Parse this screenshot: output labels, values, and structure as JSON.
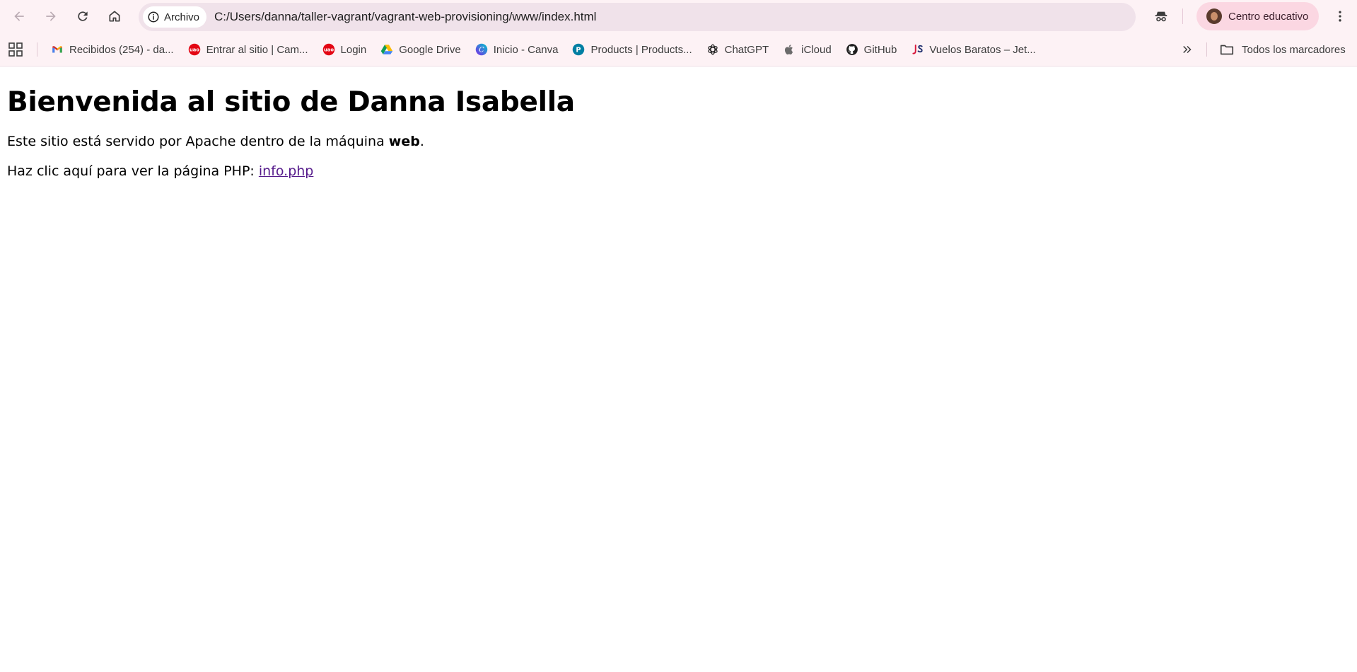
{
  "toolbar": {
    "back_icon": "arrow-left-icon",
    "forward_icon": "arrow-right-icon",
    "reload_icon": "reload-icon",
    "home_icon": "home-icon",
    "site_chip_label": "Archivo",
    "url": "C:/Users/danna/taller-vagrant/vagrant-web-provisioning/www/index.html",
    "profile_label": "Centro educativo"
  },
  "bookmarks": {
    "items": [
      {
        "label": "Recibidos (254) - da...",
        "icon": "gmail-icon"
      },
      {
        "label": "Entrar al sitio | Cam...",
        "icon": "uao-icon"
      },
      {
        "label": "Login",
        "icon": "uao-icon"
      },
      {
        "label": "Google Drive",
        "icon": "google-drive-icon"
      },
      {
        "label": "Inicio - Canva",
        "icon": "canva-icon"
      },
      {
        "label": "Products | Products...",
        "icon": "pearson-icon"
      },
      {
        "label": "ChatGPT",
        "icon": "chatgpt-icon"
      },
      {
        "label": "iCloud",
        "icon": "apple-icon"
      },
      {
        "label": "GitHub",
        "icon": "github-icon"
      },
      {
        "label": "Vuelos Baratos – Jet...",
        "icon": "jetsmart-icon"
      }
    ],
    "all_bookmarks_label": "Todos los marcadores"
  },
  "page": {
    "heading": "Bienvenida al sitio de Danna Isabella",
    "line1_before": "Este sitio está servido por Apache dentro de la máquina ",
    "line1_bold": "web",
    "line1_after": ".",
    "line2_before": "Haz clic aquí para ver la página PHP: ",
    "line2_link": "info.php"
  },
  "colors": {
    "toolbar_bg": "#fdf2f5",
    "omnibox_bg": "#f0e2ea",
    "profile_chip_bg": "#fbd7e2",
    "visited_link": "#551a8b"
  }
}
